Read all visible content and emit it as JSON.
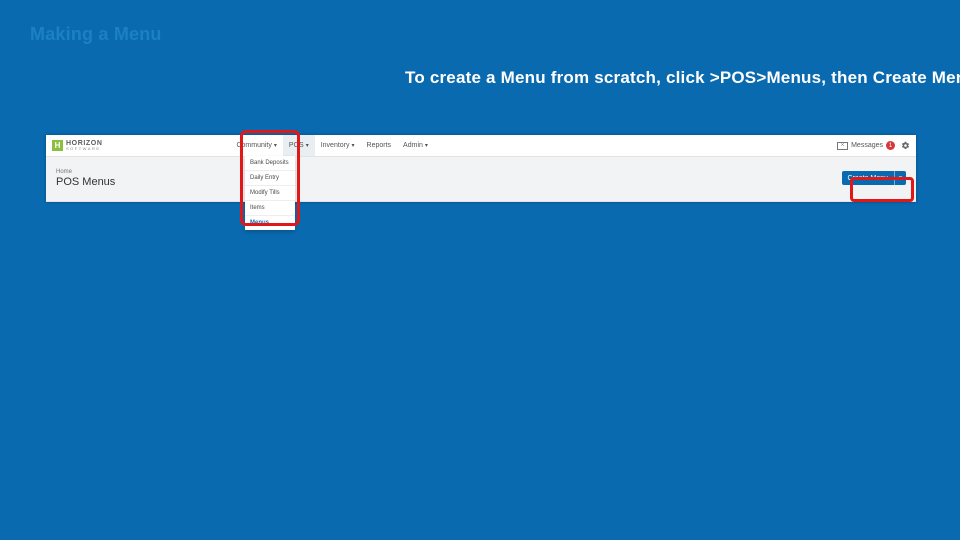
{
  "slide": {
    "title": "Making a Menu",
    "instruction": "To create a Menu from scratch, click >POS>Menus, then Create Menu"
  },
  "app": {
    "logo": {
      "mark": "H",
      "brand": "HORIZON",
      "sub": "SOFTWARE"
    },
    "nav": {
      "community": "Community",
      "pos": "POS",
      "inventory": "Inventory",
      "reports": "Reports",
      "admin": "Admin"
    },
    "dropdown": {
      "bank_deposits": "Bank Deposits",
      "daily_entry": "Daily Entry",
      "modify_tills": "Modify Tills",
      "items": "Items",
      "menus": "Menus"
    },
    "messages": {
      "label": "Messages",
      "count": "1"
    },
    "breadcrumb": "Home",
    "page_title": "POS Menus",
    "create_button": "Create Menu",
    "caret": "▾"
  }
}
